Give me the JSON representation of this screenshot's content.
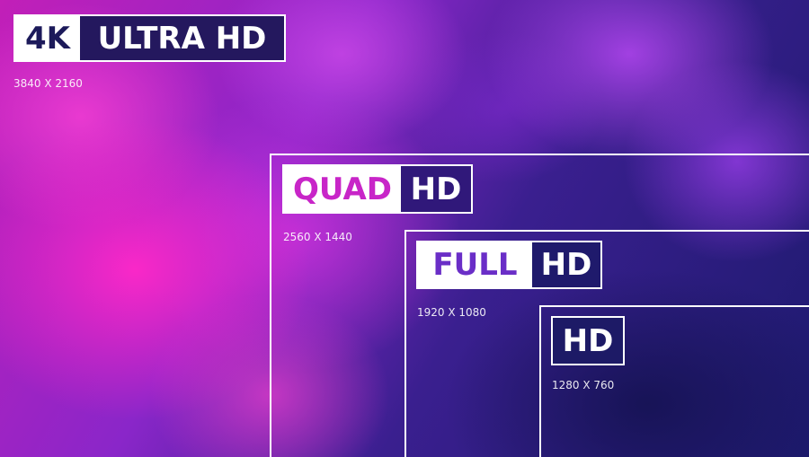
{
  "badges": {
    "uhd": {
      "part_a": "4K",
      "part_b": "ULTRA HD",
      "resolution": "3840 X 2160"
    },
    "qhd": {
      "part_a": "QUAD",
      "part_b": "HD",
      "resolution": "2560 X 1440"
    },
    "fhd": {
      "part_a": "FULL",
      "part_b": "HD",
      "resolution": "1920 X 1080"
    },
    "hd": {
      "part_b": "HD",
      "resolution": "1280 X 760"
    }
  },
  "colors": {
    "white": "#ffffff",
    "deep_navy": "#1d1a66",
    "magenta": "#c825c8",
    "violet": "#6a2ec7"
  }
}
